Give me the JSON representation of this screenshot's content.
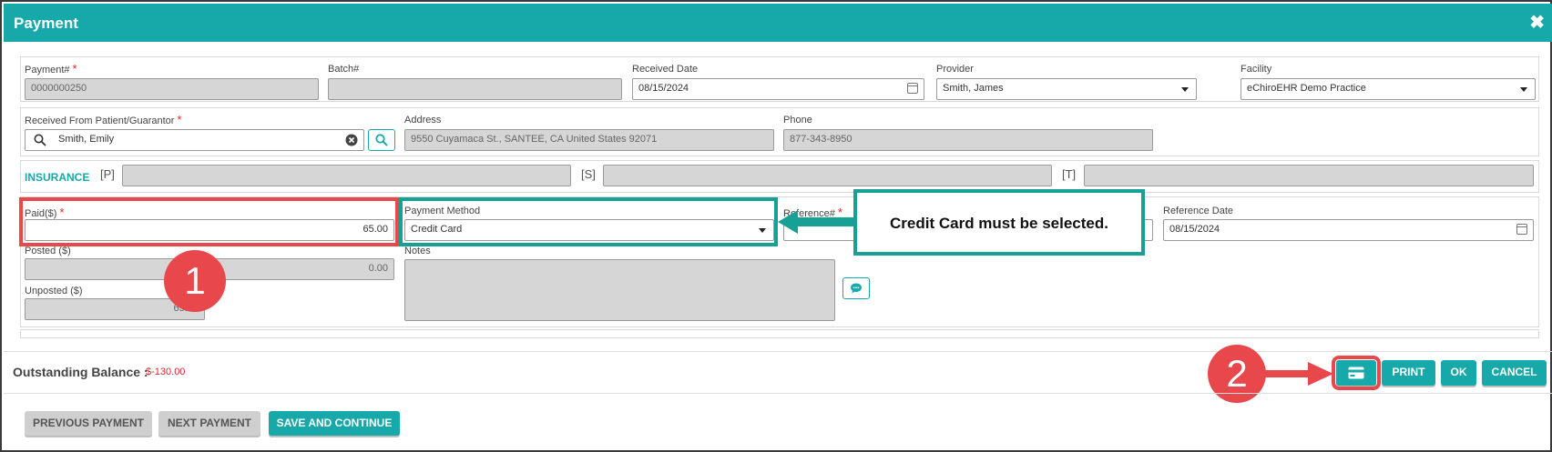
{
  "window": {
    "title": "Payment",
    "close_glyph": "✖"
  },
  "payment_no": {
    "label": "Payment#",
    "value": "0000000250"
  },
  "batch_no": {
    "label": "Batch#",
    "value": ""
  },
  "received_date": {
    "label": "Received Date",
    "value": "08/15/2024"
  },
  "provider": {
    "label": "Provider",
    "value": "Smith, James"
  },
  "facility": {
    "label": "Facility",
    "value": "eChiroEHR Demo Practice"
  },
  "received_from": {
    "label": "Received From Patient/Guarantor",
    "value": "Smith, Emily"
  },
  "address": {
    "label": "Address",
    "value": "9550 Cuyamaca St., SANTEE, CA United States 92071"
  },
  "phone": {
    "label": "Phone",
    "value": "877-343-8950"
  },
  "insurance": {
    "title": "INSURANCE",
    "primary_tag": "[P]",
    "secondary_tag": "[S]",
    "tertiary_tag": "[T]"
  },
  "paid": {
    "label": "Paid($)",
    "value": "65.00"
  },
  "payment_method": {
    "label": "Payment Method",
    "value": "Credit Card"
  },
  "reference_no": {
    "label": "Reference#",
    "value": ""
  },
  "reference_date": {
    "label": "Reference Date",
    "value": "08/15/2024"
  },
  "posted": {
    "label": "Posted ($)",
    "value": "0.00"
  },
  "unposted": {
    "label": "Unposted ($)",
    "value": "65.00"
  },
  "notes": {
    "label": "Notes",
    "value": ""
  },
  "required_mark": "*",
  "callout": {
    "text": "Credit Card must be selected."
  },
  "steps": {
    "one": "1",
    "two": "2"
  },
  "footer": {
    "outstanding_label": "Outstanding Balance :",
    "outstanding_value": "$-130.00",
    "print_label": "PRINT",
    "ok_label": "OK",
    "cancel_label": "CANCEL",
    "previous_label": "PREVIOUS PAYMENT",
    "next_label": "NEXT PAYMENT",
    "save_label": "SAVE AND CONTINUE"
  },
  "colors": {
    "accent": "#17a9a9",
    "highlight_red": "#e8474c",
    "highlight_teal": "#17a095",
    "balance_red": "#d9232d"
  }
}
